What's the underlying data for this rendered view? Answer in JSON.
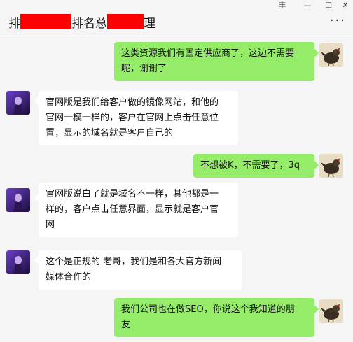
{
  "window": {
    "title_start": "排",
    "title_middle": "排名总",
    "title_end": "理",
    "pin_label": "丰",
    "minimize_label": "—",
    "maximize_label": "☐",
    "close_label": "✕",
    "more_label": "···"
  },
  "colors": {
    "my_bubble": "#95ec69",
    "their_bubble": "#ffffff",
    "redaction": "#ff0000",
    "background": "#f5f5f5"
  },
  "messages": [
    {
      "sender": "me",
      "text": "这类资源我们有固定供应商了，这边不需要\n呢，谢谢了"
    },
    {
      "sender": "them",
      "text": "官网版是我们给客户做的镜像网站，和他的\n官网一模一样的，客户在官网上点击任意位\n置，显示的域名就是客户自己的"
    },
    {
      "sender": "me",
      "text": "不想被K，不需要了，3q"
    },
    {
      "sender": "them",
      "text": "官网版说白了就是域名不一样，其他都是一\n样的，客户点击任意界面，显示就是客户官\n网"
    },
    {
      "sender": "them",
      "text": "这个是正规的 老哥，我们是和各大官方新闻\n媒体合作的"
    },
    {
      "sender": "me",
      "text": "我们公司也在做SEO，你说这个我知道的朋\n友"
    }
  ]
}
